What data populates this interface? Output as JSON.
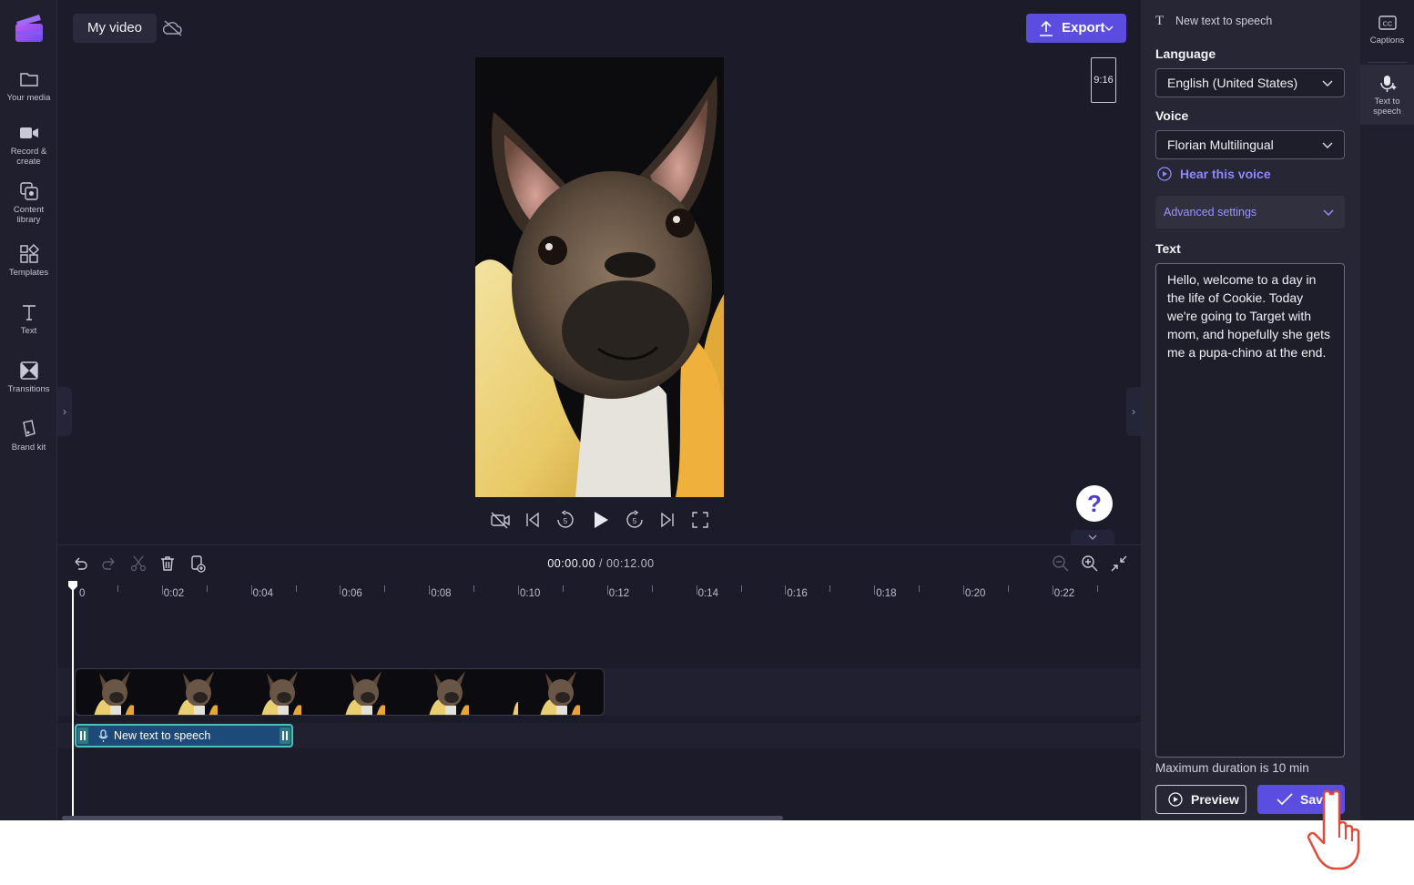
{
  "app": {
    "project_title": "My video",
    "export_label": "Export",
    "aspect_ratio": "9:16",
    "help_label": "?",
    "accent_color": "#5b4de0"
  },
  "left_nav": [
    {
      "label": "Your media",
      "icon": "folder-icon"
    },
    {
      "label": "Record &\ncreate",
      "icon": "video-camera-icon"
    },
    {
      "label": "Content\nlibrary",
      "icon": "content-library-icon"
    },
    {
      "label": "Templates",
      "icon": "templates-icon"
    },
    {
      "label": "Text",
      "icon": "text-icon"
    },
    {
      "label": "Transitions",
      "icon": "transitions-icon"
    },
    {
      "label": "Brand kit",
      "icon": "brand-kit-icon"
    }
  ],
  "timeline": {
    "current_time": "00:00.00",
    "separator": " / ",
    "total_time": "00:12.00",
    "ruler_labels": [
      "0",
      "0:02",
      "0:04",
      "0:06",
      "0:08",
      "0:10",
      "0:12",
      "0:14",
      "0:16",
      "0:18",
      "0:20",
      "0:22"
    ],
    "tts_clip_label": "New text to speech"
  },
  "panel": {
    "header": "New text to speech",
    "language_label": "Language",
    "language_value": "English (United States)",
    "voice_label": "Voice",
    "voice_value": "Florian Multilingual",
    "hear_voice": "Hear this voice",
    "advanced_settings": "Advanced settings",
    "text_label": "Text",
    "text_value": "Hello, welcome to a day in the life of Cookie. Today we're going to Target with mom, and hopefully she gets me a pupa-chino at the end.",
    "max_duration": "Maximum duration is 10 min",
    "preview_label": "Preview",
    "save_label": "Save"
  },
  "right_rail": [
    {
      "label": "Captions",
      "icon": "captions-icon"
    },
    {
      "label": "Text to\nspeech",
      "icon": "text-to-speech-icon"
    }
  ]
}
